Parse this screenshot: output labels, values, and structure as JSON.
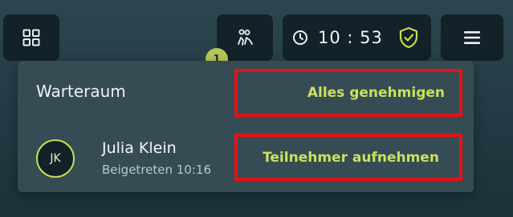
{
  "toolbar": {
    "grid_icon": "grid-icon",
    "people_icon": "people-icon",
    "clock_icon": "clock-icon",
    "time": "10 : 53",
    "shield_icon": "shield-check-icon",
    "menu_icon": "hamburger-icon",
    "waiting_count": "1"
  },
  "waiting_room": {
    "title": "Warteraum",
    "approve_all_label": "Alles genehmigen",
    "participants": [
      {
        "initials": "JK",
        "name": "Julia Klein",
        "joined": "Beigetreten 10:16",
        "admit_label": "Teilnehmer aufnehmen"
      }
    ]
  },
  "colors": {
    "accent": "#cde05b",
    "highlight_border": "#e41414",
    "panel": "#364c55",
    "toolbar_button": "#132129"
  }
}
